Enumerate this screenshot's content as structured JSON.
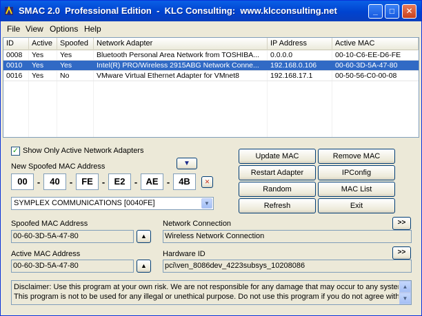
{
  "window": {
    "title": "SMAC 2.0  Professional Edition  -  KLC Consulting:  www.klcconsulting.net",
    "minimize": "_",
    "maximize": "□",
    "close": "✕"
  },
  "menu": [
    "File",
    "View",
    "Options",
    "Help"
  ],
  "adapters": {
    "columns": [
      "ID",
      "Active",
      "Spoofed",
      "Network Adapter",
      "IP Address",
      "Active MAC"
    ],
    "rows": [
      {
        "id": "0008",
        "active": "Yes",
        "spoofed": "Yes",
        "adapter": "Bluetooth Personal Area Network from TOSHIBA...",
        "ip": "0.0.0.0",
        "mac": "00-10-C6-EE-D6-FE",
        "selected": false
      },
      {
        "id": "0010",
        "active": "Yes",
        "spoofed": "Yes",
        "adapter": "Intel(R) PRO/Wireless 2915ABG Network Conne...",
        "ip": "192.168.0.106",
        "mac": "00-60-3D-5A-47-80",
        "selected": true
      },
      {
        "id": "0016",
        "active": "Yes",
        "spoofed": "No",
        "adapter": "VMware Virtual Ethernet Adapter for VMnet8",
        "ip": "192.168.17.1",
        "mac": "00-50-56-C0-00-08",
        "selected": false
      }
    ]
  },
  "options": {
    "show_active_label": "Show Only Active Network Adapters",
    "show_active_checked": true
  },
  "new_mac": {
    "label": "New Spoofed MAC Address",
    "octets": [
      "00",
      "40",
      "FE",
      "E2",
      "AE",
      "4B"
    ],
    "clear": "✕"
  },
  "vendor": {
    "selected": "SYMPLEX COMMUNICATIONS [0040FE]"
  },
  "buttons": {
    "update_mac": "Update MAC",
    "remove_mac": "Remove MAC",
    "restart_adapter": "Restart Adapter",
    "ipconfig": "IPConfig",
    "random": "Random",
    "mac_list": "MAC List",
    "refresh": "Refresh",
    "exit": "Exit",
    "expand": ">>"
  },
  "details": {
    "spoofed_label": "Spoofed MAC Address",
    "spoofed_value": "00-60-3D-5A-47-80",
    "active_label": "Active MAC Address",
    "active_value": "00-60-3D-5A-47-80",
    "connection_label": "Network Connection",
    "connection_value": "Wireless Network Connection",
    "hardware_label": "Hardware ID",
    "hardware_value": "pci\\ven_8086dev_4223subsys_10208086"
  },
  "disclaimer": {
    "line1": "Disclaimer: Use this program at your own risk.  We are not responsible for any damage that may occur to any system.",
    "line2": "This program is not to be used for any illegal or unethical purpose.  Do not use this program if you do not agree with"
  },
  "icons": {
    "app": "smac-icon",
    "arrow_up": "▲",
    "arrow_down": "▼"
  }
}
